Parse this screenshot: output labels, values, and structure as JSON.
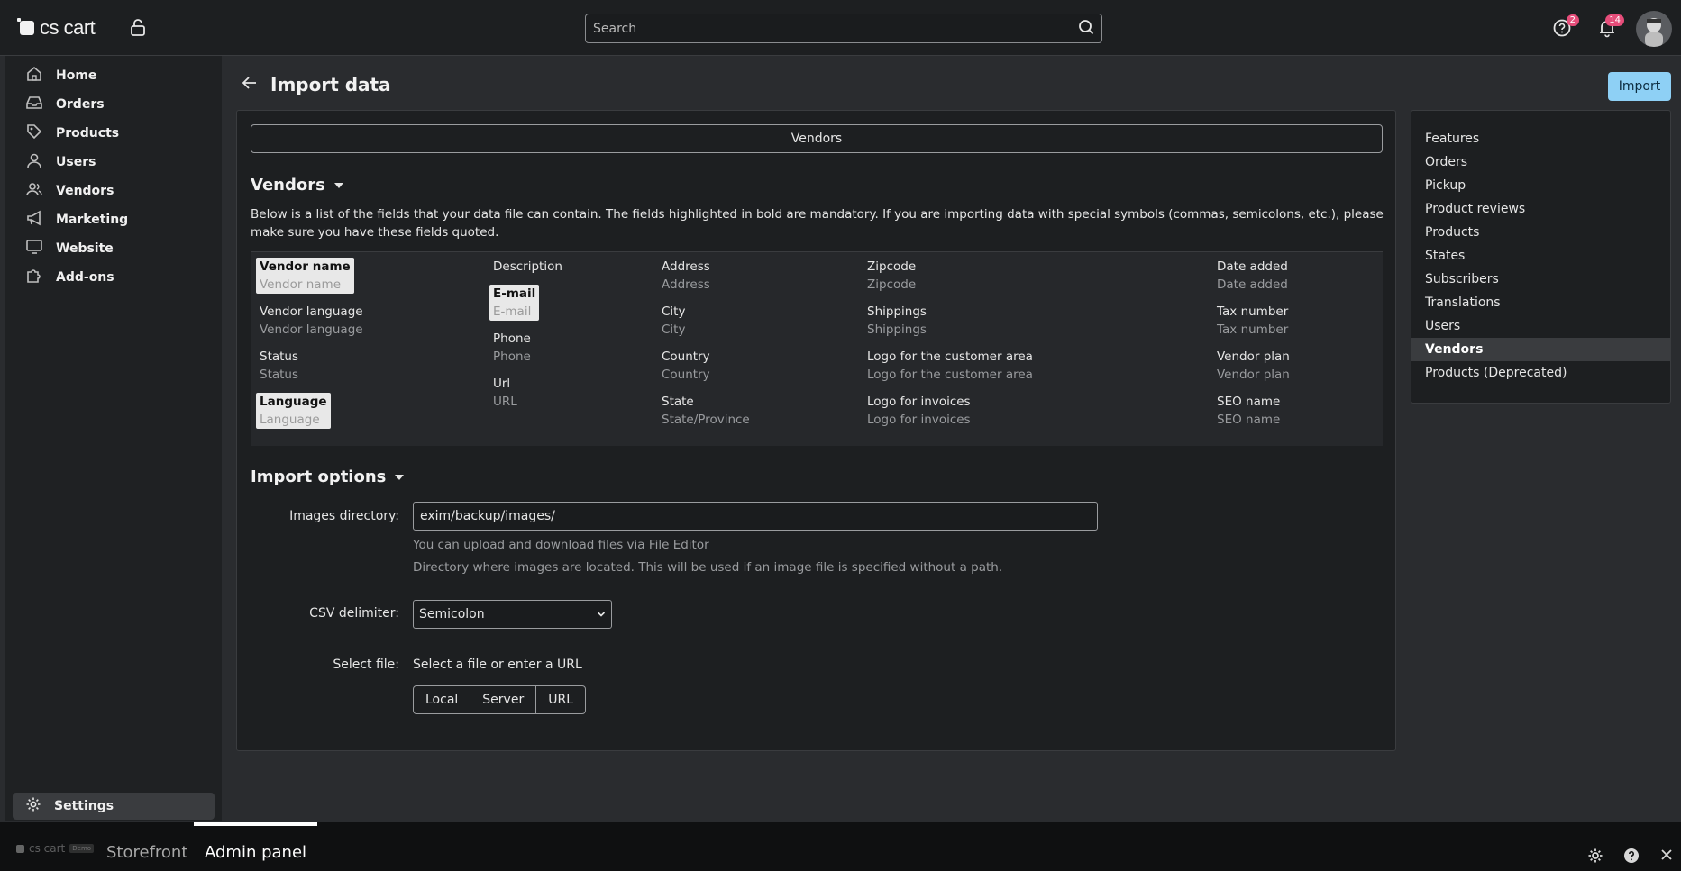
{
  "header": {
    "logo_text": "cs cart",
    "search_placeholder": "Search",
    "help_badge": "2",
    "notifications_badge": "14"
  },
  "sidebar": {
    "items": [
      {
        "label": "Home",
        "icon": "home-icon"
      },
      {
        "label": "Orders",
        "icon": "inbox-icon"
      },
      {
        "label": "Products",
        "icon": "tag-icon"
      },
      {
        "label": "Users",
        "icon": "user-icon"
      },
      {
        "label": "Vendors",
        "icon": "users-icon"
      },
      {
        "label": "Marketing",
        "icon": "megaphone-icon"
      },
      {
        "label": "Website",
        "icon": "monitor-icon"
      },
      {
        "label": "Add-ons",
        "icon": "puzzle-icon"
      }
    ],
    "settings_label": "Settings"
  },
  "page": {
    "title": "Import data",
    "import_button": "Import",
    "section_selector": "Vendors",
    "section_heading": "Vendors",
    "description": "Below is a list of the fields that your data file can contain. The fields highlighted in bold are mandatory. If you are importing data with special symbols (commas, semicolons, etc.), please make sure you have these fields quoted.",
    "fields": [
      {
        "name": "Vendor name",
        "hint": "Vendor name",
        "required": true
      },
      {
        "name": "Vendor language",
        "hint": "Vendor language",
        "required": false
      },
      {
        "name": "Status",
        "hint": "Status",
        "required": false
      },
      {
        "name": "Language",
        "hint": "Language",
        "required": true
      },
      {
        "name": "Description",
        "hint": "",
        "required": false
      },
      {
        "name": "E-mail",
        "hint": "E-mail",
        "required": true
      },
      {
        "name": "Phone",
        "hint": "Phone",
        "required": false
      },
      {
        "name": "Url",
        "hint": "URL",
        "required": false
      },
      {
        "name": "Address",
        "hint": "Address",
        "required": false
      },
      {
        "name": "City",
        "hint": "City",
        "required": false
      },
      {
        "name": "Country",
        "hint": "Country",
        "required": false
      },
      {
        "name": "State",
        "hint": "State/Province",
        "required": false
      },
      {
        "name": "Zipcode",
        "hint": "Zipcode",
        "required": false
      },
      {
        "name": "Shippings",
        "hint": "Shippings",
        "required": false
      },
      {
        "name": "Logo for the customer area",
        "hint": "Logo for the customer area",
        "required": false
      },
      {
        "name": "Logo for invoices",
        "hint": "Logo for invoices",
        "required": false
      },
      {
        "name": "Date added",
        "hint": "Date added",
        "required": false
      },
      {
        "name": "Tax number",
        "hint": "Tax number",
        "required": false
      },
      {
        "name": "Vendor plan",
        "hint": "Vendor plan",
        "required": false
      },
      {
        "name": "SEO name",
        "hint": "SEO name",
        "required": false
      }
    ],
    "import_options": {
      "heading": "Import options",
      "images_dir_label": "Images directory:",
      "images_dir_value": "exim/backup/images/",
      "images_help_1": "You can upload and download files via File Editor",
      "images_help_2": "Directory where images are located. This will be used if an image file is specified without a path.",
      "csv_label": "CSV delimiter:",
      "csv_value": "Semicolon",
      "file_label": "Select file:",
      "file_hint": "Select a file or enter a URL",
      "file_buttons": [
        "Local",
        "Server",
        "URL"
      ]
    }
  },
  "side_panel": {
    "links": [
      "Features",
      "Orders",
      "Pickup",
      "Product reviews",
      "Products",
      "States",
      "Subscribers",
      "Translations",
      "Users",
      "Vendors",
      "Products (Deprecated)"
    ],
    "active": "Vendors"
  },
  "bottom_bar": {
    "logo_text": "cs cart",
    "demo_badge": "Demo",
    "tabs": [
      "Storefront",
      "Admin panel"
    ],
    "active_tab": "Admin panel"
  }
}
